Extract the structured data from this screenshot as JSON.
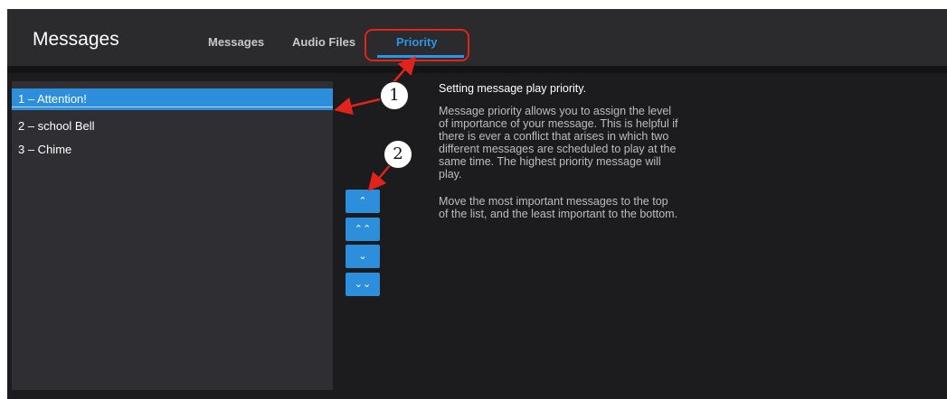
{
  "app": {
    "title": "Messages"
  },
  "tabs": [
    {
      "label": "Messages"
    },
    {
      "label": "Audio Files"
    },
    {
      "label": "Priority",
      "active": true
    }
  ],
  "priority_list": [
    {
      "label": "1 – Attention!",
      "selected": true
    },
    {
      "label": "2 – school Bell"
    },
    {
      "label": "3 – Chime"
    }
  ],
  "move_buttons": [
    {
      "glyph": "⌃",
      "icon": "chevron-up-icon"
    },
    {
      "glyph": "⌃⌃",
      "icon": "double-chevron-up-icon"
    },
    {
      "glyph": "⌄",
      "icon": "chevron-down-icon"
    },
    {
      "glyph": "⌄⌄",
      "icon": "double-chevron-down-icon"
    }
  ],
  "info": {
    "title": "Setting message play priority.",
    "paragraph1": "Message priority allows you to assign the level of importance of your message. This is helpful if there is ever a conflict that arises in which two different messages are scheduled to play at the same time. The highest priority message will play.",
    "paragraph2": "Move the most important messages to the top of the list, and the least important to the bottom."
  },
  "callouts": [
    {
      "number": "1"
    },
    {
      "number": "2"
    }
  ],
  "colors": {
    "accent": "#2d8fdb",
    "callout_red": "#e0241b",
    "background": "#1c1c1e"
  }
}
